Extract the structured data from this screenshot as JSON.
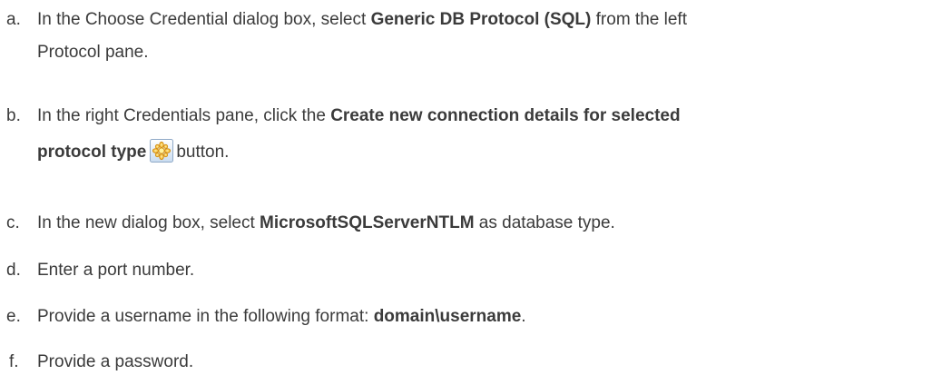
{
  "steps": [
    {
      "marker": "a.",
      "segments": [
        {
          "text": "In the Choose Credential dialog box, select ",
          "bold": false
        },
        {
          "text": "Generic DB Protocol (SQL)",
          "bold": true
        },
        {
          "text": " from the left",
          "bold": false
        },
        {
          "break": true
        },
        {
          "text": "Protocol pane.",
          "bold": false
        }
      ]
    },
    {
      "marker": "b.",
      "segments": [
        {
          "text": "In the right Credentials pane, click the ",
          "bold": false
        },
        {
          "text": "Create new connection details for selected",
          "bold": true
        },
        {
          "break": true
        },
        {
          "text": "protocol type",
          "bold": true
        },
        {
          "icon": "create-new-connection-icon"
        },
        {
          "text": "button.",
          "bold": false
        }
      ]
    },
    {
      "marker": "c.",
      "segments": [
        {
          "text": "In the new dialog box, select ",
          "bold": false
        },
        {
          "text": "MicrosoftSQLServerNTLM",
          "bold": true
        },
        {
          "text": " as database type.",
          "bold": false
        }
      ]
    },
    {
      "marker": "d.",
      "segments": [
        {
          "text": "Enter a port number.",
          "bold": false
        }
      ]
    },
    {
      "marker": "e.",
      "segments": [
        {
          "text": "Provide a username in the following format: ",
          "bold": false
        },
        {
          "text": "domain\\username",
          "bold": true
        },
        {
          "text": ".",
          "bold": false
        }
      ]
    },
    {
      "marker": "f.",
      "segments": [
        {
          "text": "Provide a password.",
          "bold": false
        }
      ]
    }
  ]
}
